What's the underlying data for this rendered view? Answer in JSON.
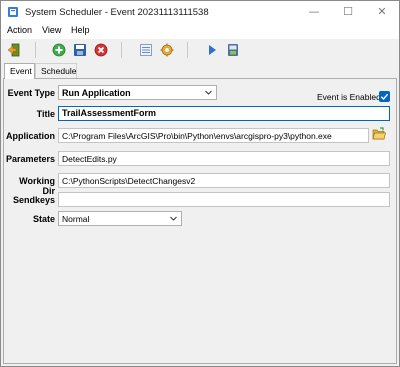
{
  "window": {
    "title": "System Scheduler - Event 20231113111538"
  },
  "menu": {
    "action": "Action",
    "view": "View",
    "help": "Help"
  },
  "toolbar_icons": [
    "exit-icon",
    "add-icon",
    "save-icon",
    "delete-icon",
    "list-icon",
    "settings-icon",
    "run-icon",
    "import-icon"
  ],
  "tabs": {
    "event": "Event",
    "schedule": "Schedule"
  },
  "form": {
    "event_type_label": "Event Type",
    "event_type_value": "Run Application",
    "event_enabled_label": "Event is Enabled",
    "event_enabled_checked": true,
    "title_label": "Title",
    "title_value": "TrailAssessmentForm",
    "application_label": "Application",
    "application_value": "C:\\Program Files\\ArcGIS\\Pro\\bin\\Python\\envs\\arcgispro-py3\\python.exe",
    "parameters_label": "Parameters",
    "parameters_value": "DetectEdits.py",
    "working_dir_label": "Working Dir",
    "working_dir_value": "C:\\PythonScripts\\DetectChangesv2",
    "sendkeys_label": "Sendkeys",
    "sendkeys_value": "",
    "state_label": "State",
    "state_value": "Normal"
  }
}
